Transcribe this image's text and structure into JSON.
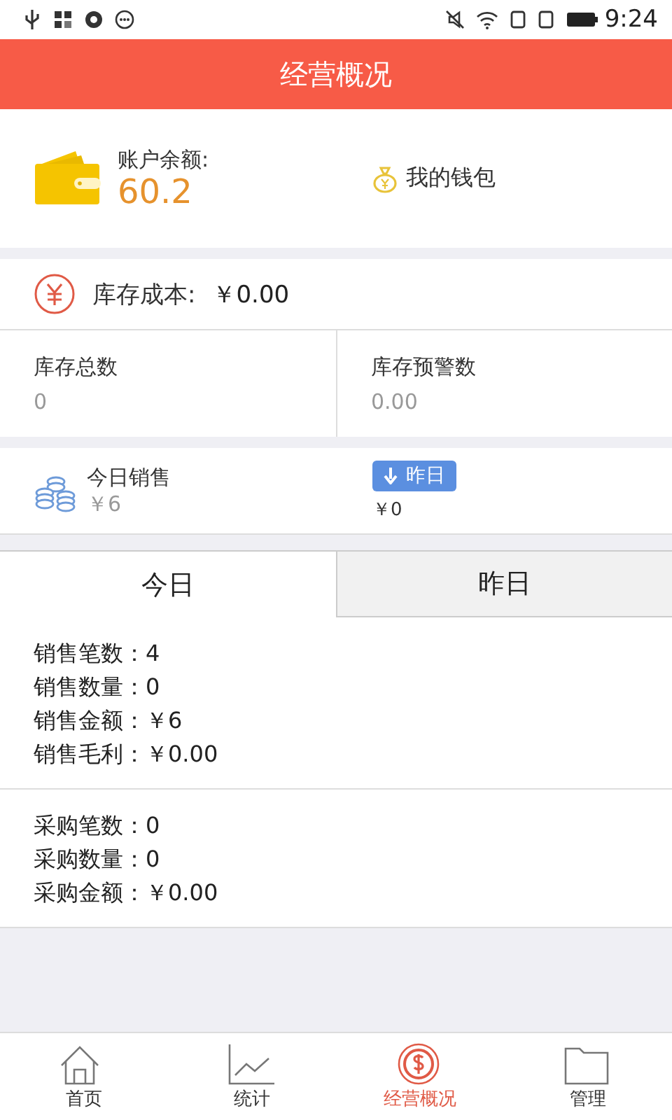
{
  "status_bar": {
    "time": "9:24"
  },
  "header": {
    "title": "经营概况"
  },
  "account": {
    "label": "账户余额:",
    "balance": "60.2",
    "wallet_link": "我的钱包"
  },
  "inventory_cost": {
    "label": "库存成本:",
    "value": "￥0.00"
  },
  "stock": [
    {
      "label": "库存总数",
      "value": "0"
    },
    {
      "label": "库存预警数",
      "value": "0.00"
    }
  ],
  "sales": {
    "label": "今日销售",
    "value": "￥6",
    "compare_badge": "昨日",
    "compare_value": "￥0"
  },
  "tabs": [
    {
      "label": "今日",
      "selected": true
    },
    {
      "label": "昨日",
      "selected": false
    }
  ],
  "groups": [
    {
      "lines": [
        "销售笔数：4",
        "销售数量：0",
        "销售金额：￥6",
        "销售毛利：￥0.00"
      ]
    },
    {
      "lines": [
        "采购笔数：0",
        "采购数量：0",
        "采购金额：￥0.00"
      ]
    }
  ],
  "nav": [
    {
      "kind": "home",
      "label": "首页",
      "selected": false
    },
    {
      "kind": "chart",
      "label": "统计",
      "selected": false
    },
    {
      "kind": "dollar",
      "label": "经营概况",
      "selected": true
    },
    {
      "kind": "folder",
      "label": "管理",
      "selected": false
    }
  ]
}
